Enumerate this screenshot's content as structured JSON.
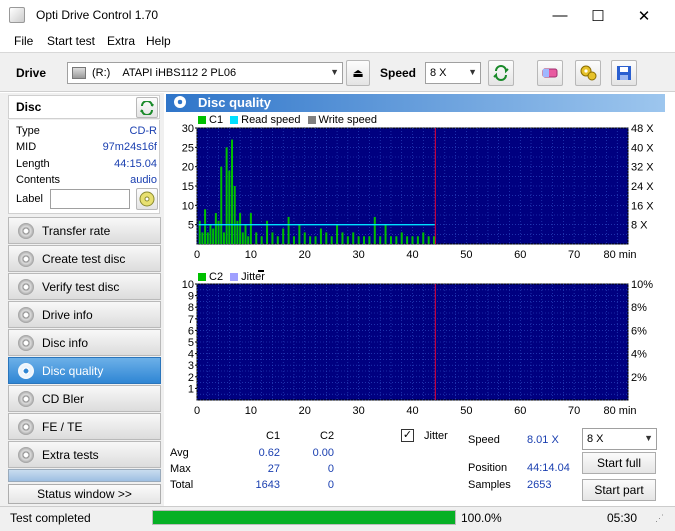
{
  "window": {
    "title": "Opti Drive Control 1.70",
    "minimize": "—",
    "maximize": "☐",
    "close": "✕"
  },
  "menu": [
    "File",
    "Start test",
    "Extra",
    "Help"
  ],
  "toolbar": {
    "drive_label": "Drive",
    "drive_letter": "(R:)",
    "drive_name": "ATAPI iHBS112  2 PL06",
    "speed_label": "Speed",
    "speed_value": "8 X"
  },
  "disc": {
    "header": "Disc",
    "fields": [
      {
        "key": "Type",
        "value": "CD-R"
      },
      {
        "key": "MID",
        "value": "97m24s16f"
      },
      {
        "key": "Length",
        "value": "44:15.04"
      },
      {
        "key": "Contents",
        "value": "audio"
      }
    ],
    "label_key": "Label",
    "label_value": ""
  },
  "nav": [
    {
      "label": "Transfer rate",
      "active": false
    },
    {
      "label": "Create test disc",
      "active": false
    },
    {
      "label": "Verify test disc",
      "active": false
    },
    {
      "label": "Drive info",
      "active": false
    },
    {
      "label": "Disc info",
      "active": false
    },
    {
      "label": "Disc quality",
      "active": true
    },
    {
      "label": "CD Bler",
      "active": false
    },
    {
      "label": "FE / TE",
      "active": false
    },
    {
      "label": "Extra tests",
      "active": false
    }
  ],
  "status_window_button": "Status window >>",
  "panel_title": "Disc quality",
  "chart_data": [
    {
      "type": "bar",
      "legend": [
        "C1",
        "Read speed",
        "Write speed"
      ],
      "colors": {
        "C1": "#00c000",
        "Read speed": "#00e0ff",
        "Write speed": "#808080",
        "plot_bg": "#000080",
        "marker": "#c00040"
      },
      "x_ticks": [
        "0",
        "10",
        "20",
        "30",
        "40",
        "50",
        "60",
        "70",
        "80 min"
      ],
      "xlim": [
        0,
        80
      ],
      "y_ticks_left": [
        "5",
        "10",
        "15",
        "20",
        "25",
        "30"
      ],
      "ylim": [
        0,
        30
      ],
      "y_ticks_right": [
        "8 X",
        "16 X",
        "24 X",
        "32 X",
        "40 X",
        "48 X"
      ],
      "marker_x": 44.25,
      "read_speed_x": 8.01,
      "c1_x": [
        0.5,
        1,
        1.5,
        2,
        2.5,
        3,
        3.5,
        4,
        4.5,
        5,
        5.5,
        6,
        6.5,
        7,
        7.5,
        8,
        8.5,
        9,
        9.5,
        10,
        11,
        12,
        13,
        14,
        15,
        16,
        17,
        18,
        19,
        20,
        21,
        22,
        23,
        24,
        25,
        26,
        27,
        28,
        29,
        30,
        31,
        32,
        33,
        34,
        35,
        36,
        37,
        38,
        39,
        40,
        41,
        42,
        43,
        44
      ],
      "c1_y": [
        6,
        3,
        9,
        3,
        5,
        4,
        8,
        6,
        20,
        3,
        25,
        19,
        27,
        15,
        6,
        8,
        3,
        5,
        2,
        8,
        3,
        2,
        6,
        3,
        2,
        4,
        7,
        2,
        5,
        3,
        2,
        2,
        4,
        3,
        2,
        5,
        3,
        2,
        3,
        2,
        2,
        2,
        7,
        2,
        5,
        2,
        2,
        3,
        2,
        2,
        2,
        3,
        2,
        2
      ]
    },
    {
      "type": "bar",
      "legend": [
        "C2",
        "Jitter"
      ],
      "colors": {
        "C2": "#00c000",
        "Jitter": "#a0a0ff",
        "plot_bg": "#000080",
        "marker": "#c00040"
      },
      "x_ticks": [
        "0",
        "10",
        "20",
        "30",
        "40",
        "50",
        "60",
        "70",
        "80 min"
      ],
      "xlim": [
        0,
        80
      ],
      "y_ticks_left": [
        "1",
        "2",
        "3",
        "4",
        "5",
        "6",
        "7",
        "8",
        "9",
        "10"
      ],
      "ylim": [
        0,
        10
      ],
      "y_ticks_right": [
        "2%",
        "4%",
        "6%",
        "8%",
        "10%"
      ],
      "marker_x": 44.25,
      "c2_values": []
    }
  ],
  "stats": {
    "col_c1": "C1",
    "col_c2": "C2",
    "rows": [
      {
        "label": "Avg",
        "c1": "0.62",
        "c2": "0.00"
      },
      {
        "label": "Max",
        "c1": "27",
        "c2": "0"
      },
      {
        "label": "Total",
        "c1": "1643",
        "c2": "0"
      }
    ],
    "jitter_label": "Jitter",
    "jitter_checked": true
  },
  "results": {
    "speed_label": "Speed",
    "speed_value": "8.01 X",
    "position_label": "Position",
    "position_value": "44:14.04",
    "samples_label": "Samples",
    "samples_value": "2653",
    "speed_select": "8 X",
    "start_full": "Start full",
    "start_part": "Start part"
  },
  "status": {
    "text": "Test completed",
    "progress": 100,
    "progress_text": "100.0%",
    "time": "05:30"
  }
}
